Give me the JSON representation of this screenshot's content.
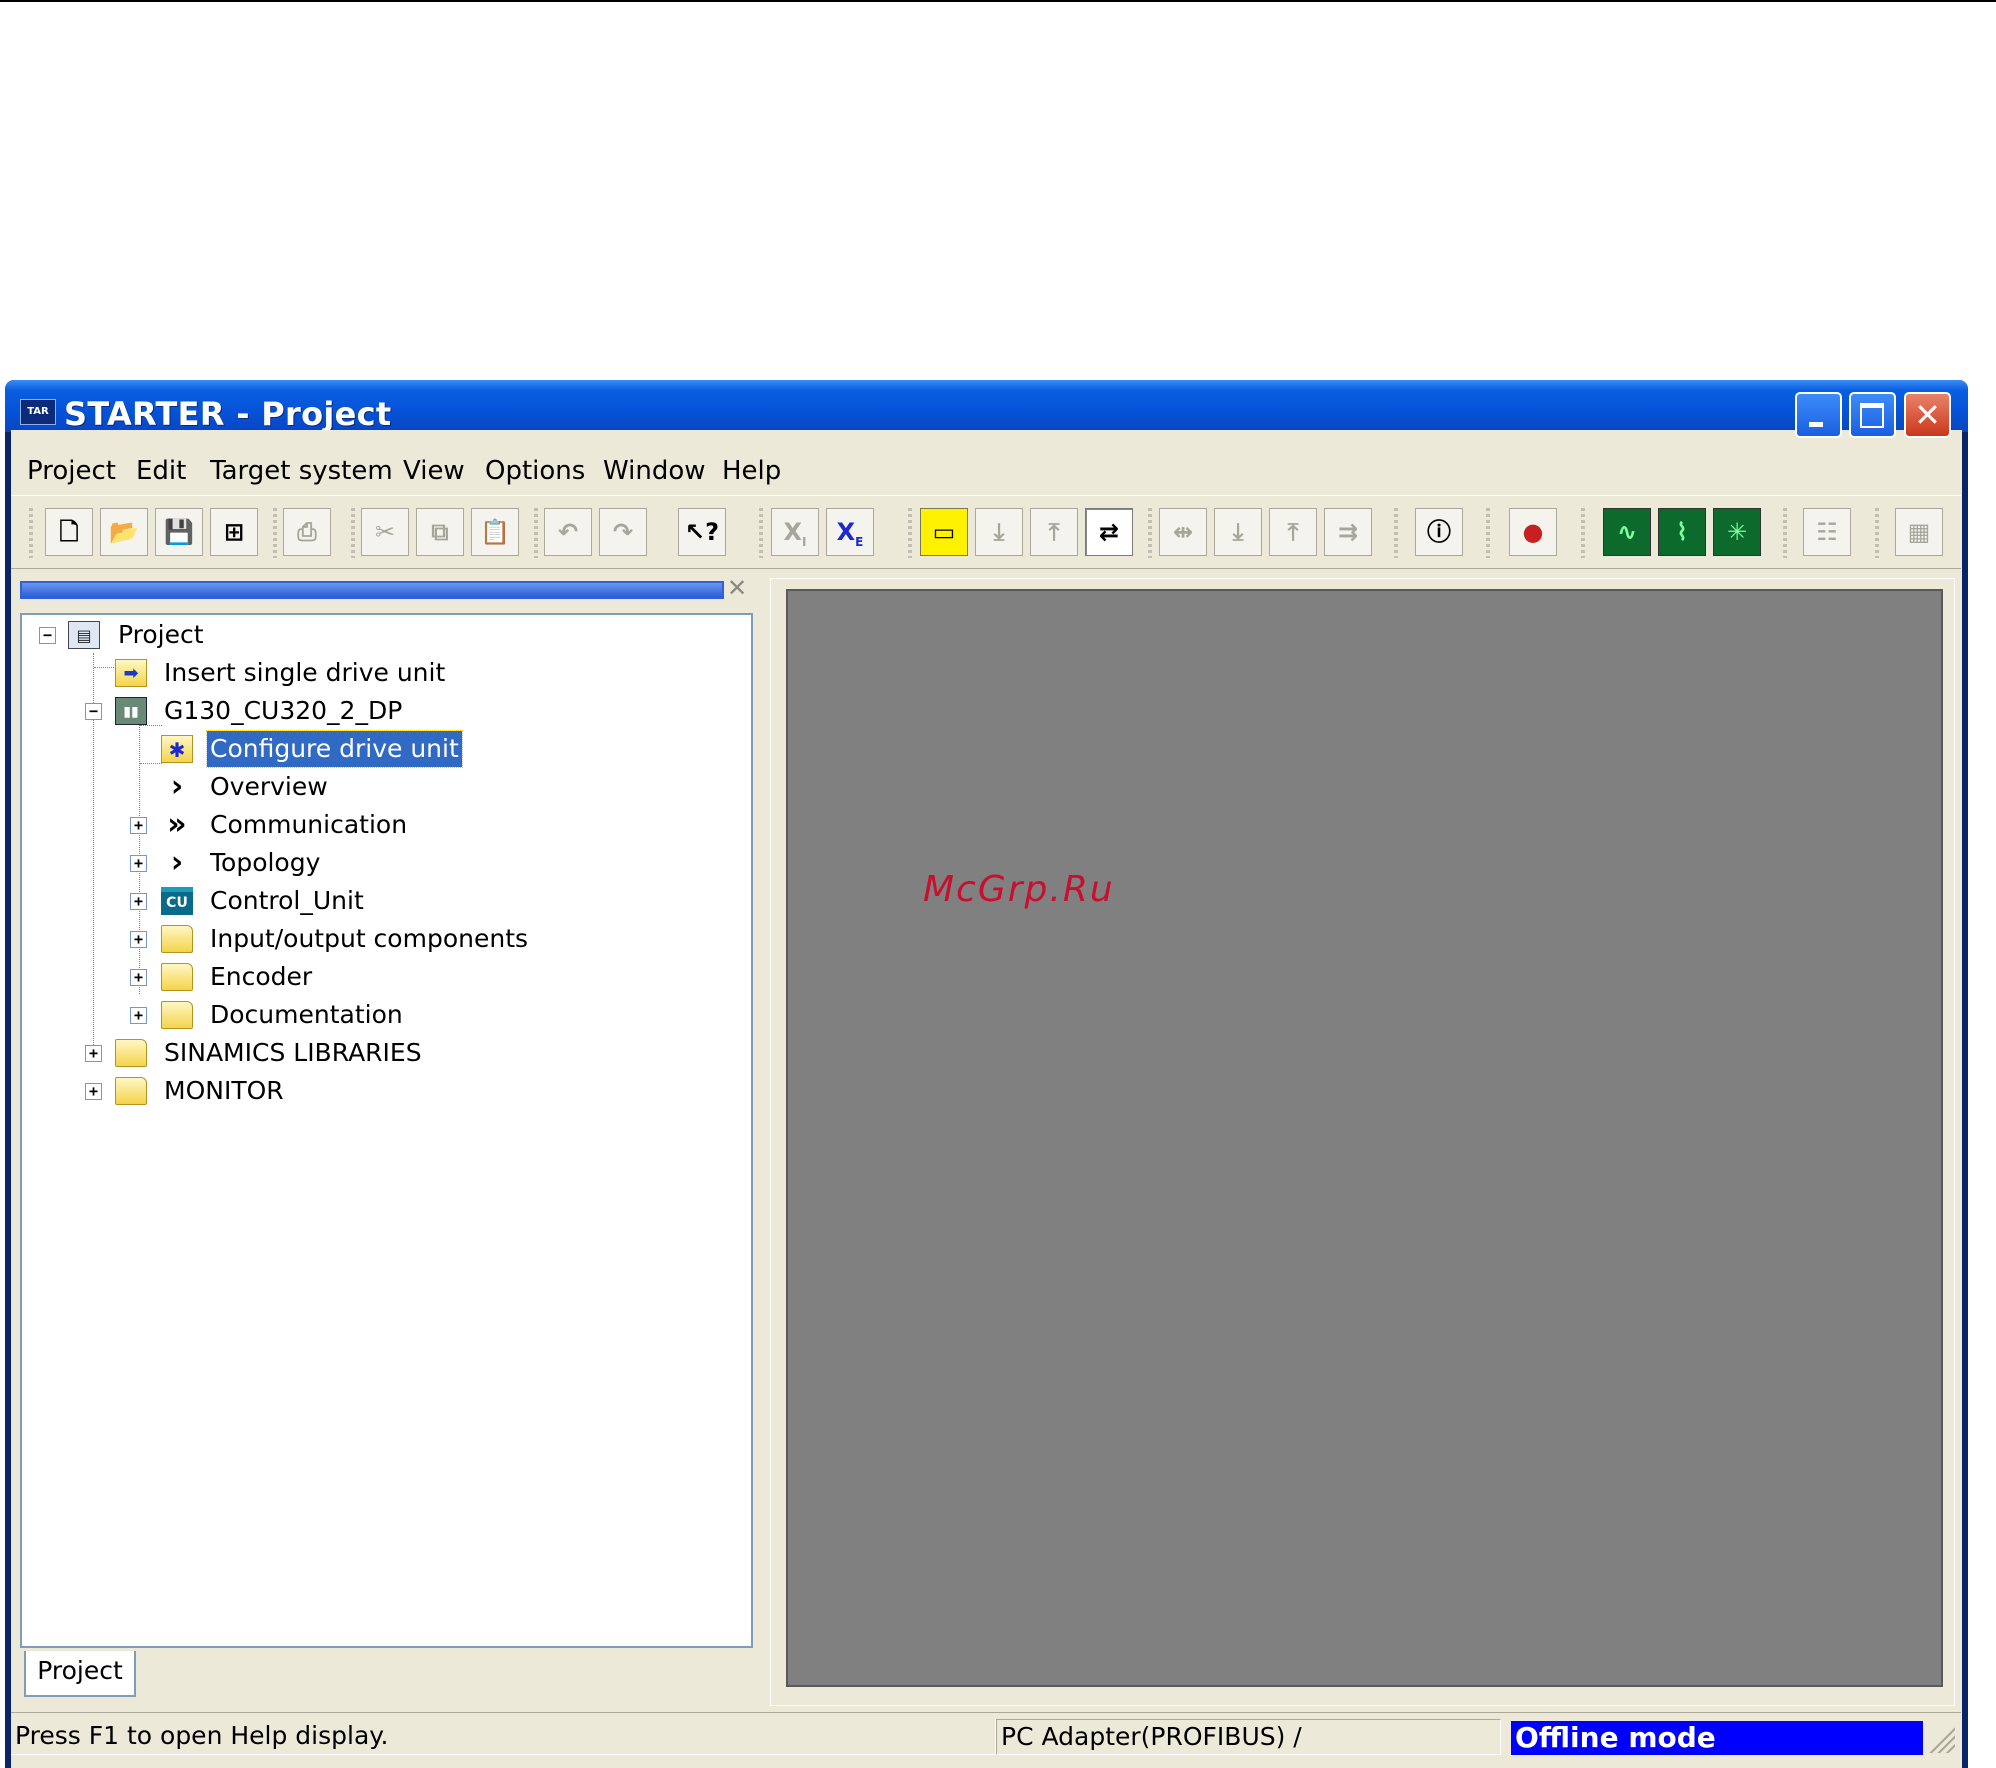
{
  "window": {
    "title": "STARTER - Project",
    "app_icon": "TAR",
    "controls": {
      "minimize": "minimize-icon",
      "maximize": "maximize-icon",
      "close": "close-icon"
    }
  },
  "menu": [
    "Project",
    "Edit",
    "Target system",
    "View",
    "Options",
    "Window",
    "Help"
  ],
  "toolbar_icons": [
    "new-icon",
    "open-icon",
    "save-icon",
    "save-compile-icon",
    "print-icon",
    "cut-icon",
    "copy-icon",
    "paste-icon",
    "undo-icon",
    "redo-icon",
    "context-help-icon",
    "xi-icon",
    "xe-icon",
    "connect-target-icon",
    "download-icon",
    "upload-icon",
    "online-offline-compare-icon",
    "disconnect-icon",
    "load-to-pg-icon",
    "load-to-target-icon",
    "copy-ram-rom-icon",
    "diagnostics-icon",
    "control-panel-icon",
    "trace-icon",
    "measure-icon",
    "function-generator-icon",
    "expert-list-icon",
    "calculator-icon"
  ],
  "tree": {
    "root": "Project",
    "items": [
      "Insert single drive unit",
      "G130_CU320_2_DP",
      "Configure drive unit",
      "Overview",
      "Communication",
      "Topology",
      "Control_Unit",
      "Input/output components",
      "Encoder",
      "Documentation",
      "SINAMICS LIBRARIES",
      "MONITOR"
    ],
    "cu_icon_text": "CU",
    "selected": "Configure drive unit",
    "tab": "Project"
  },
  "watermark": "McGrp.Ru",
  "status": {
    "help": "Press F1 to open Help display.",
    "interface": "PC Adapter(PROFIBUS) /",
    "mode": "Offline mode"
  },
  "colors": {
    "titlebar": "#0553d8",
    "selection": "#316ac5",
    "workspace": "#808080",
    "offline_mode": "#0000ff",
    "watermark": "#c8102e"
  }
}
